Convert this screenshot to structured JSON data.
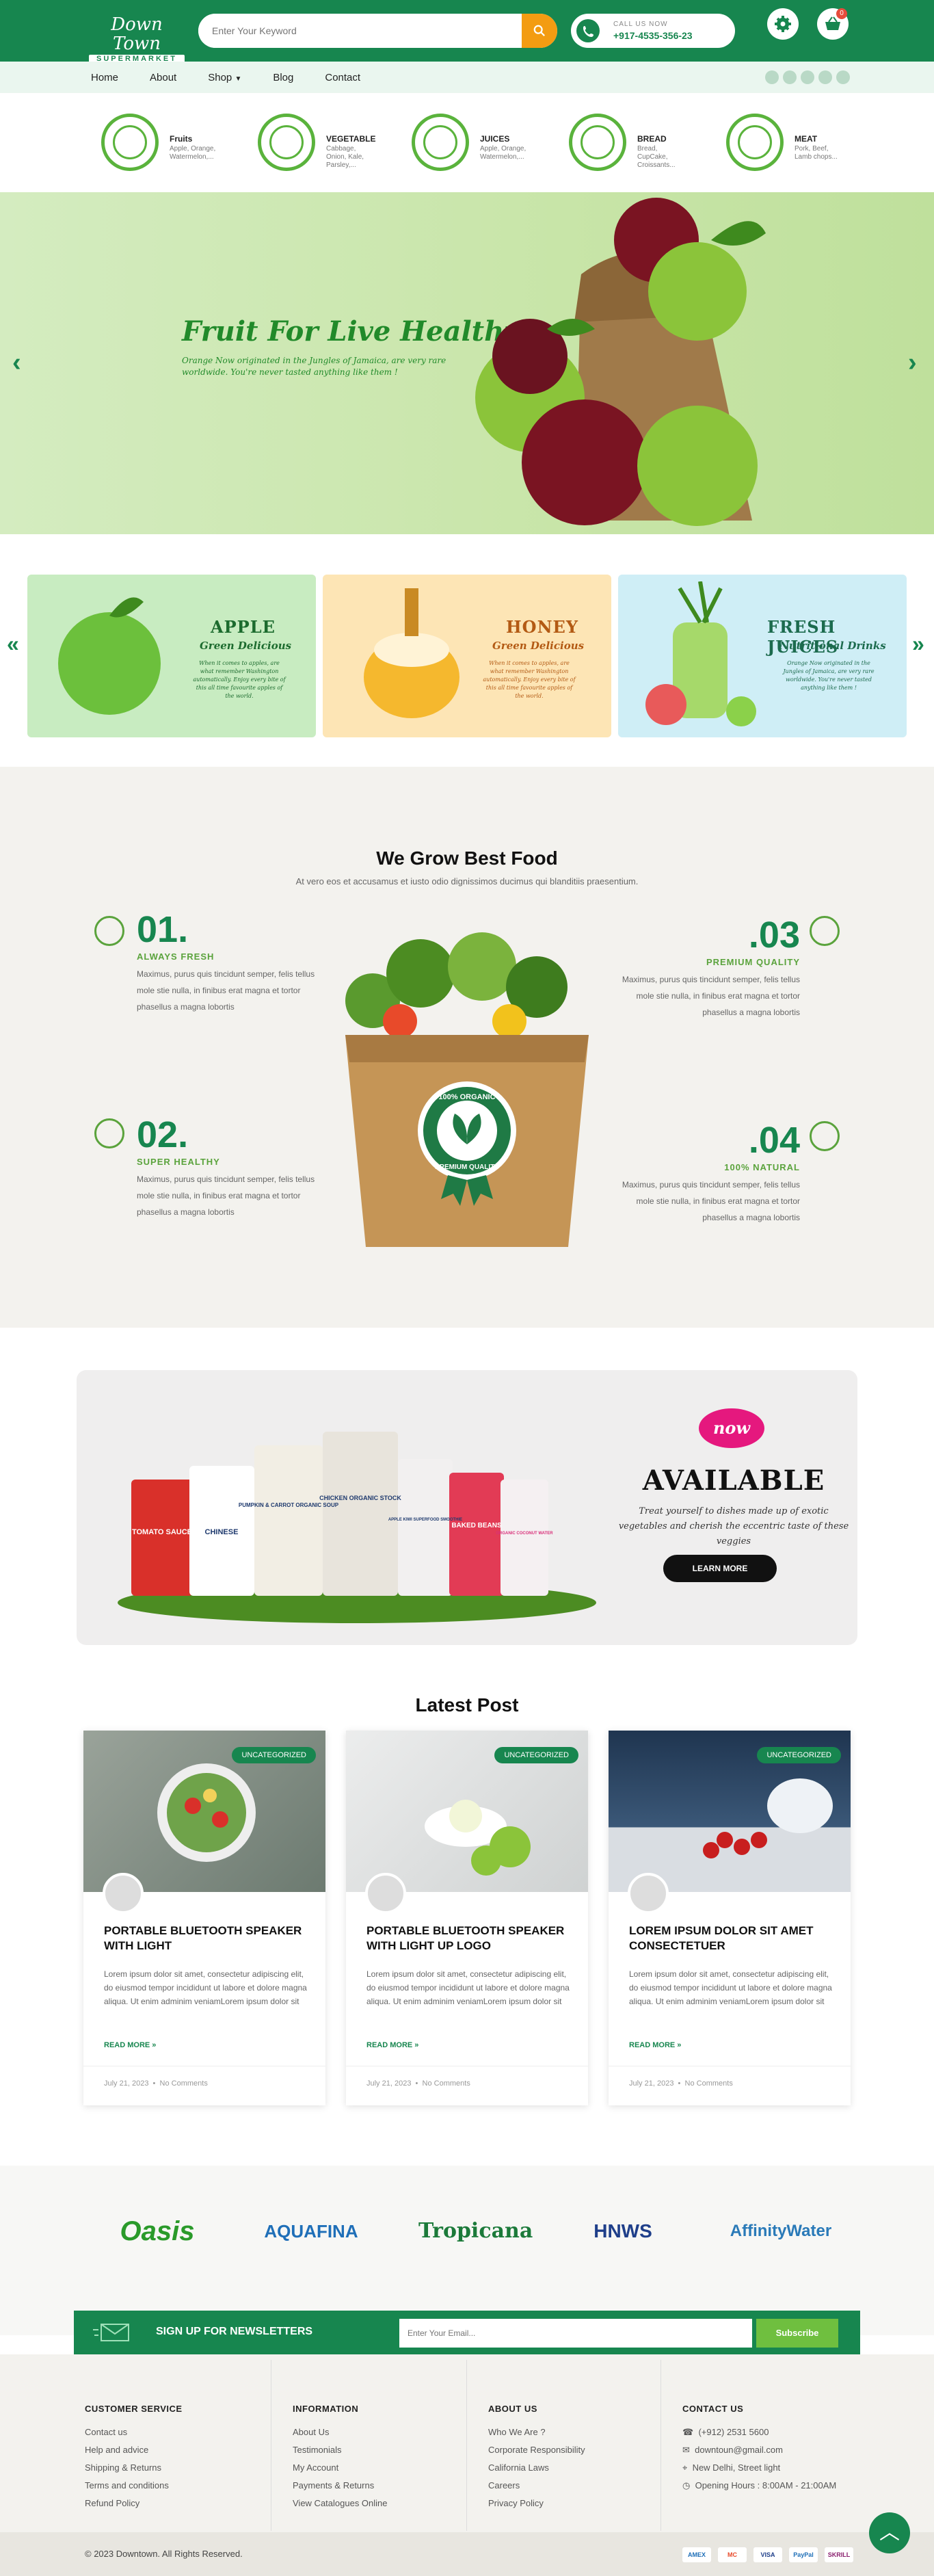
{
  "header": {
    "logo_line1": "Down Town",
    "logo_line2": "SUPERMARKET",
    "search_placeholder": "Enter Your Keyword",
    "call_label": "CALL US NOW",
    "call_number": "+917-4535-356-23",
    "cart_count": "0"
  },
  "nav": {
    "items": [
      "Home",
      "About",
      "Shop",
      "Blog",
      "Contact"
    ]
  },
  "categories": [
    {
      "name": "Fruits",
      "desc": "Apple, Orange, Watermelon,..."
    },
    {
      "name": "VEGETABLE",
      "desc": "Cabbage, Onion, Kale, Parsley,..."
    },
    {
      "name": "JUICES",
      "desc": "Apple, Orange, Watermelon,..."
    },
    {
      "name": "BREAD",
      "desc": "Bread, CupCake, Croissants..."
    },
    {
      "name": "MEAT",
      "desc": "Pork, Beef, Lamb chops..."
    }
  ],
  "hero": {
    "title": "Fruit For Live Healthy",
    "text": "Orange Now originated in the Jungles of Jamaica, are very rare worldwide. You're never tasted anything like them !"
  },
  "banners": [
    {
      "title": "APPLE",
      "subtitle": "Green Delicious",
      "text": "When it comes to apples, are what remember Washington automatically. Enjoy every bite of this all time favourite apples of the world."
    },
    {
      "title": "HONEY",
      "subtitle": "Green Delicious",
      "text": "When it comes to apples, are what remember Washington automatically. Enjoy every bite of this all time favourite apples of the world."
    },
    {
      "title": "FRESH JUICES",
      "subtitle": "Nutritional Drinks",
      "text": "Orange Now originated in the Jungles of Jamaica, are very rare worldwide. You're never tasted anything like them !"
    }
  ],
  "grow": {
    "title": "We Grow Best Food",
    "subtitle": "At vero eos et accusamus et iusto odio dignissimos ducimus qui blanditiis praesentium.",
    "features": [
      {
        "num": "01.",
        "title": "ALWAYS FRESH",
        "text": "Maximus, purus quis tincidunt semper, felis tellus mole stie nulla, in finibus erat magna et tortor phasellus a magna lobortis"
      },
      {
        "num": ".03",
        "title": "PREMIUM QUALITY",
        "text": "Maximus, purus quis tincidunt semper, felis tellus mole stie nulla, in finibus erat magna et tortor phasellus a magna lobortis"
      },
      {
        "num": "02.",
        "title": "SUPER HEALTHY",
        "text": "Maximus, purus quis tincidunt semper, felis tellus mole stie nulla, in finibus erat magna et tortor phasellus a magna lobortis"
      },
      {
        "num": ".04",
        "title": "100% NATURAL",
        "text": "Maximus, purus quis tincidunt semper, felis tellus mole stie nulla, in finibus erat magna et tortor phasellus a magna lobortis"
      }
    ],
    "seal_top": "100% ORGANIC",
    "seal_bottom": "PREMIUM QUALITY"
  },
  "available": {
    "badge": "now",
    "title": "AVAILABLE",
    "text": "Treat yourself to dishes made up of exotic vegetables and cherish the eccentric taste of these veggies",
    "button": "LEARN MORE",
    "products": [
      "TOMATO SAUCE",
      "CHINESE",
      "PUMPKIN & CARROT ORGANIC SOUP",
      "CHICKEN ORGANIC STOCK",
      "APPLE KIWI SUPERFOOD SMOOTHIE",
      "BAKED BEANS",
      "ORGANIC COCONUT WATER"
    ]
  },
  "posts": {
    "title": "Latest Post",
    "items": [
      {
        "tag": "UNCATEGORIZED",
        "title": "PORTABLE BLUETOOTH SPEAKER WITH LIGHT",
        "text": "Lorem ipsum dolor sit amet, consectetur adipiscing elit, do eiusmod tempor incididunt ut labore et dolore magna aliqua. Ut enim adminim veniamLorem ipsum dolor sit",
        "read": "READ MORE »",
        "date": "July 21, 2023",
        "comments": "No Comments"
      },
      {
        "tag": "UNCATEGORIZED",
        "title": "PORTABLE BLUETOOTH SPEAKER WITH LIGHT UP LOGO",
        "text": "Lorem ipsum dolor sit amet, consectetur adipiscing elit, do eiusmod tempor incididunt ut labore et dolore magna aliqua. Ut enim adminim veniamLorem ipsum dolor sit",
        "read": "READ MORE »",
        "date": "July 21, 2023",
        "comments": "No Comments"
      },
      {
        "tag": "UNCATEGORIZED",
        "title": "LOREM IPSUM DOLOR SIT AMET CONSECTETUER",
        "text": "Lorem ipsum dolor sit amet, consectetur adipiscing elit, do eiusmod tempor incididunt ut labore et dolore magna aliqua. Ut enim adminim veniamLorem ipsum dolor sit",
        "read": "READ MORE »",
        "date": "July 21, 2023",
        "comments": "No Comments"
      }
    ]
  },
  "brands": [
    "Oasis",
    "AQUAFINA",
    "Tropicana",
    "HNWS",
    "AffinityWater"
  ],
  "newsletter": {
    "title": "SIGN UP FOR NEWSLETTERS",
    "placeholder": "Enter Your Email...",
    "button": "Subscribe"
  },
  "footer": {
    "columns": [
      {
        "title": "CUSTOMER SERVICE",
        "items": [
          "Contact us",
          "Help and advice",
          "Shipping & Returns",
          "Terms and conditions",
          "Refund Policy"
        ]
      },
      {
        "title": "INFORMATION",
        "items": [
          "About Us",
          "Testimonials",
          "My Account",
          "Payments & Returns",
          "View Catalogues Online"
        ]
      },
      {
        "title": "ABOUT US",
        "items": [
          "Who We Are ?",
          "Corporate Responsibility",
          "California Laws",
          "Careers",
          "Privacy Policy"
        ]
      },
      {
        "title": "CONTACT US",
        "items": [
          "(+912) 2531 5600",
          "downtoun@gmail.com",
          "New Delhi, Street light",
          "Opening Hours : 8:00AM - 21:00AM"
        ]
      }
    ],
    "copyright": "© 2023 Downtown. All Rights Reserved.",
    "payments": [
      "AMEX",
      "MC",
      "VISA",
      "PayPal",
      "SKRILL"
    ]
  },
  "colors": {
    "primary": "#17864f",
    "accent": "#f39c12",
    "leaf": "#5ab33c"
  }
}
